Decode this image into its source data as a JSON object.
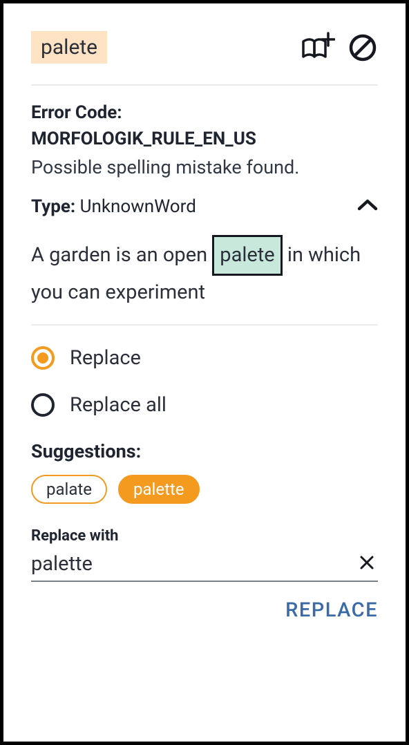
{
  "header": {
    "word": "palete"
  },
  "error": {
    "code_label": "Error Code:",
    "code_value": "MORFOLOGIK_RULE_EN_US",
    "message": "Possible spelling mistake found.",
    "type_label": "Type:",
    "type_value": "UnknownWord"
  },
  "context": {
    "before": "A garden is an open ",
    "highlight": "palete",
    "after": " in which you can experiment"
  },
  "options": {
    "replace": "Replace",
    "replace_all": "Replace all",
    "selected": "replace"
  },
  "suggestions": {
    "label": "Suggestions:",
    "items": [
      "palate",
      "palette"
    ],
    "active_index": 1
  },
  "replace_with": {
    "label": "Replace with",
    "value": "palette"
  },
  "actions": {
    "replace": "REPLACE"
  }
}
